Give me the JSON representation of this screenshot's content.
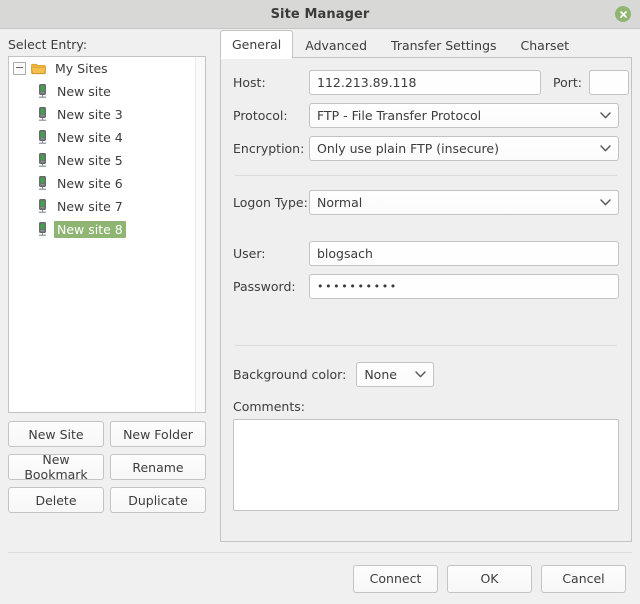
{
  "window": {
    "title": "Site Manager",
    "close_icon": "close-icon"
  },
  "left_pane": {
    "select_entry_label": "Select Entry:",
    "tree": {
      "root": {
        "label": "My Sites",
        "icon": "folder-icon",
        "expander": "collapse-minus-icon",
        "expanded": true
      },
      "children": [
        {
          "label": "New site",
          "icon": "server-icon",
          "selected": false
        },
        {
          "label": "New site 3",
          "icon": "server-icon",
          "selected": false
        },
        {
          "label": "New site 4",
          "icon": "server-icon",
          "selected": false
        },
        {
          "label": "New site 5",
          "icon": "server-icon",
          "selected": false
        },
        {
          "label": "New site 6",
          "icon": "server-icon",
          "selected": false
        },
        {
          "label": "New site 7",
          "icon": "server-icon",
          "selected": false
        },
        {
          "label": "New site 8",
          "icon": "server-icon",
          "selected": true
        }
      ]
    },
    "buttons": [
      {
        "label": "New Site"
      },
      {
        "label": "New Folder"
      },
      {
        "label": "New Bookmark"
      },
      {
        "label": "Rename"
      },
      {
        "label": "Delete"
      },
      {
        "label": "Duplicate"
      }
    ]
  },
  "right_pane": {
    "tabs": [
      {
        "label": "General",
        "active": true
      },
      {
        "label": "Advanced",
        "active": false
      },
      {
        "label": "Transfer Settings",
        "active": false
      },
      {
        "label": "Charset",
        "active": false
      }
    ],
    "general": {
      "host_label": "Host:",
      "host_value": "112.213.89.118",
      "port_label": "Port:",
      "port_value": "",
      "protocol_label": "Protocol:",
      "protocol_value": "FTP - File Transfer Protocol",
      "encryption_label": "Encryption:",
      "encryption_value": "Only use plain FTP (insecure)",
      "logon_type_label": "Logon Type:",
      "logon_type_value": "Normal",
      "user_label": "User:",
      "user_value": "blogsach",
      "password_label": "Password:",
      "password_value": "••••••••••",
      "background_color_label": "Background color:",
      "background_color_value": "None",
      "comments_label": "Comments:",
      "comments_value": ""
    }
  },
  "footer": {
    "connect_label": "Connect",
    "ok_label": "OK",
    "cancel_label": "Cancel"
  },
  "colors": {
    "titlebar": "#d8d8d6",
    "body": "#f0f0f0",
    "selection_green": "#8fb573",
    "close_green": "#8fb573",
    "folder_amber": "#e8a93a",
    "border": "#c3c3c1",
    "text": "#3c3c3c"
  }
}
